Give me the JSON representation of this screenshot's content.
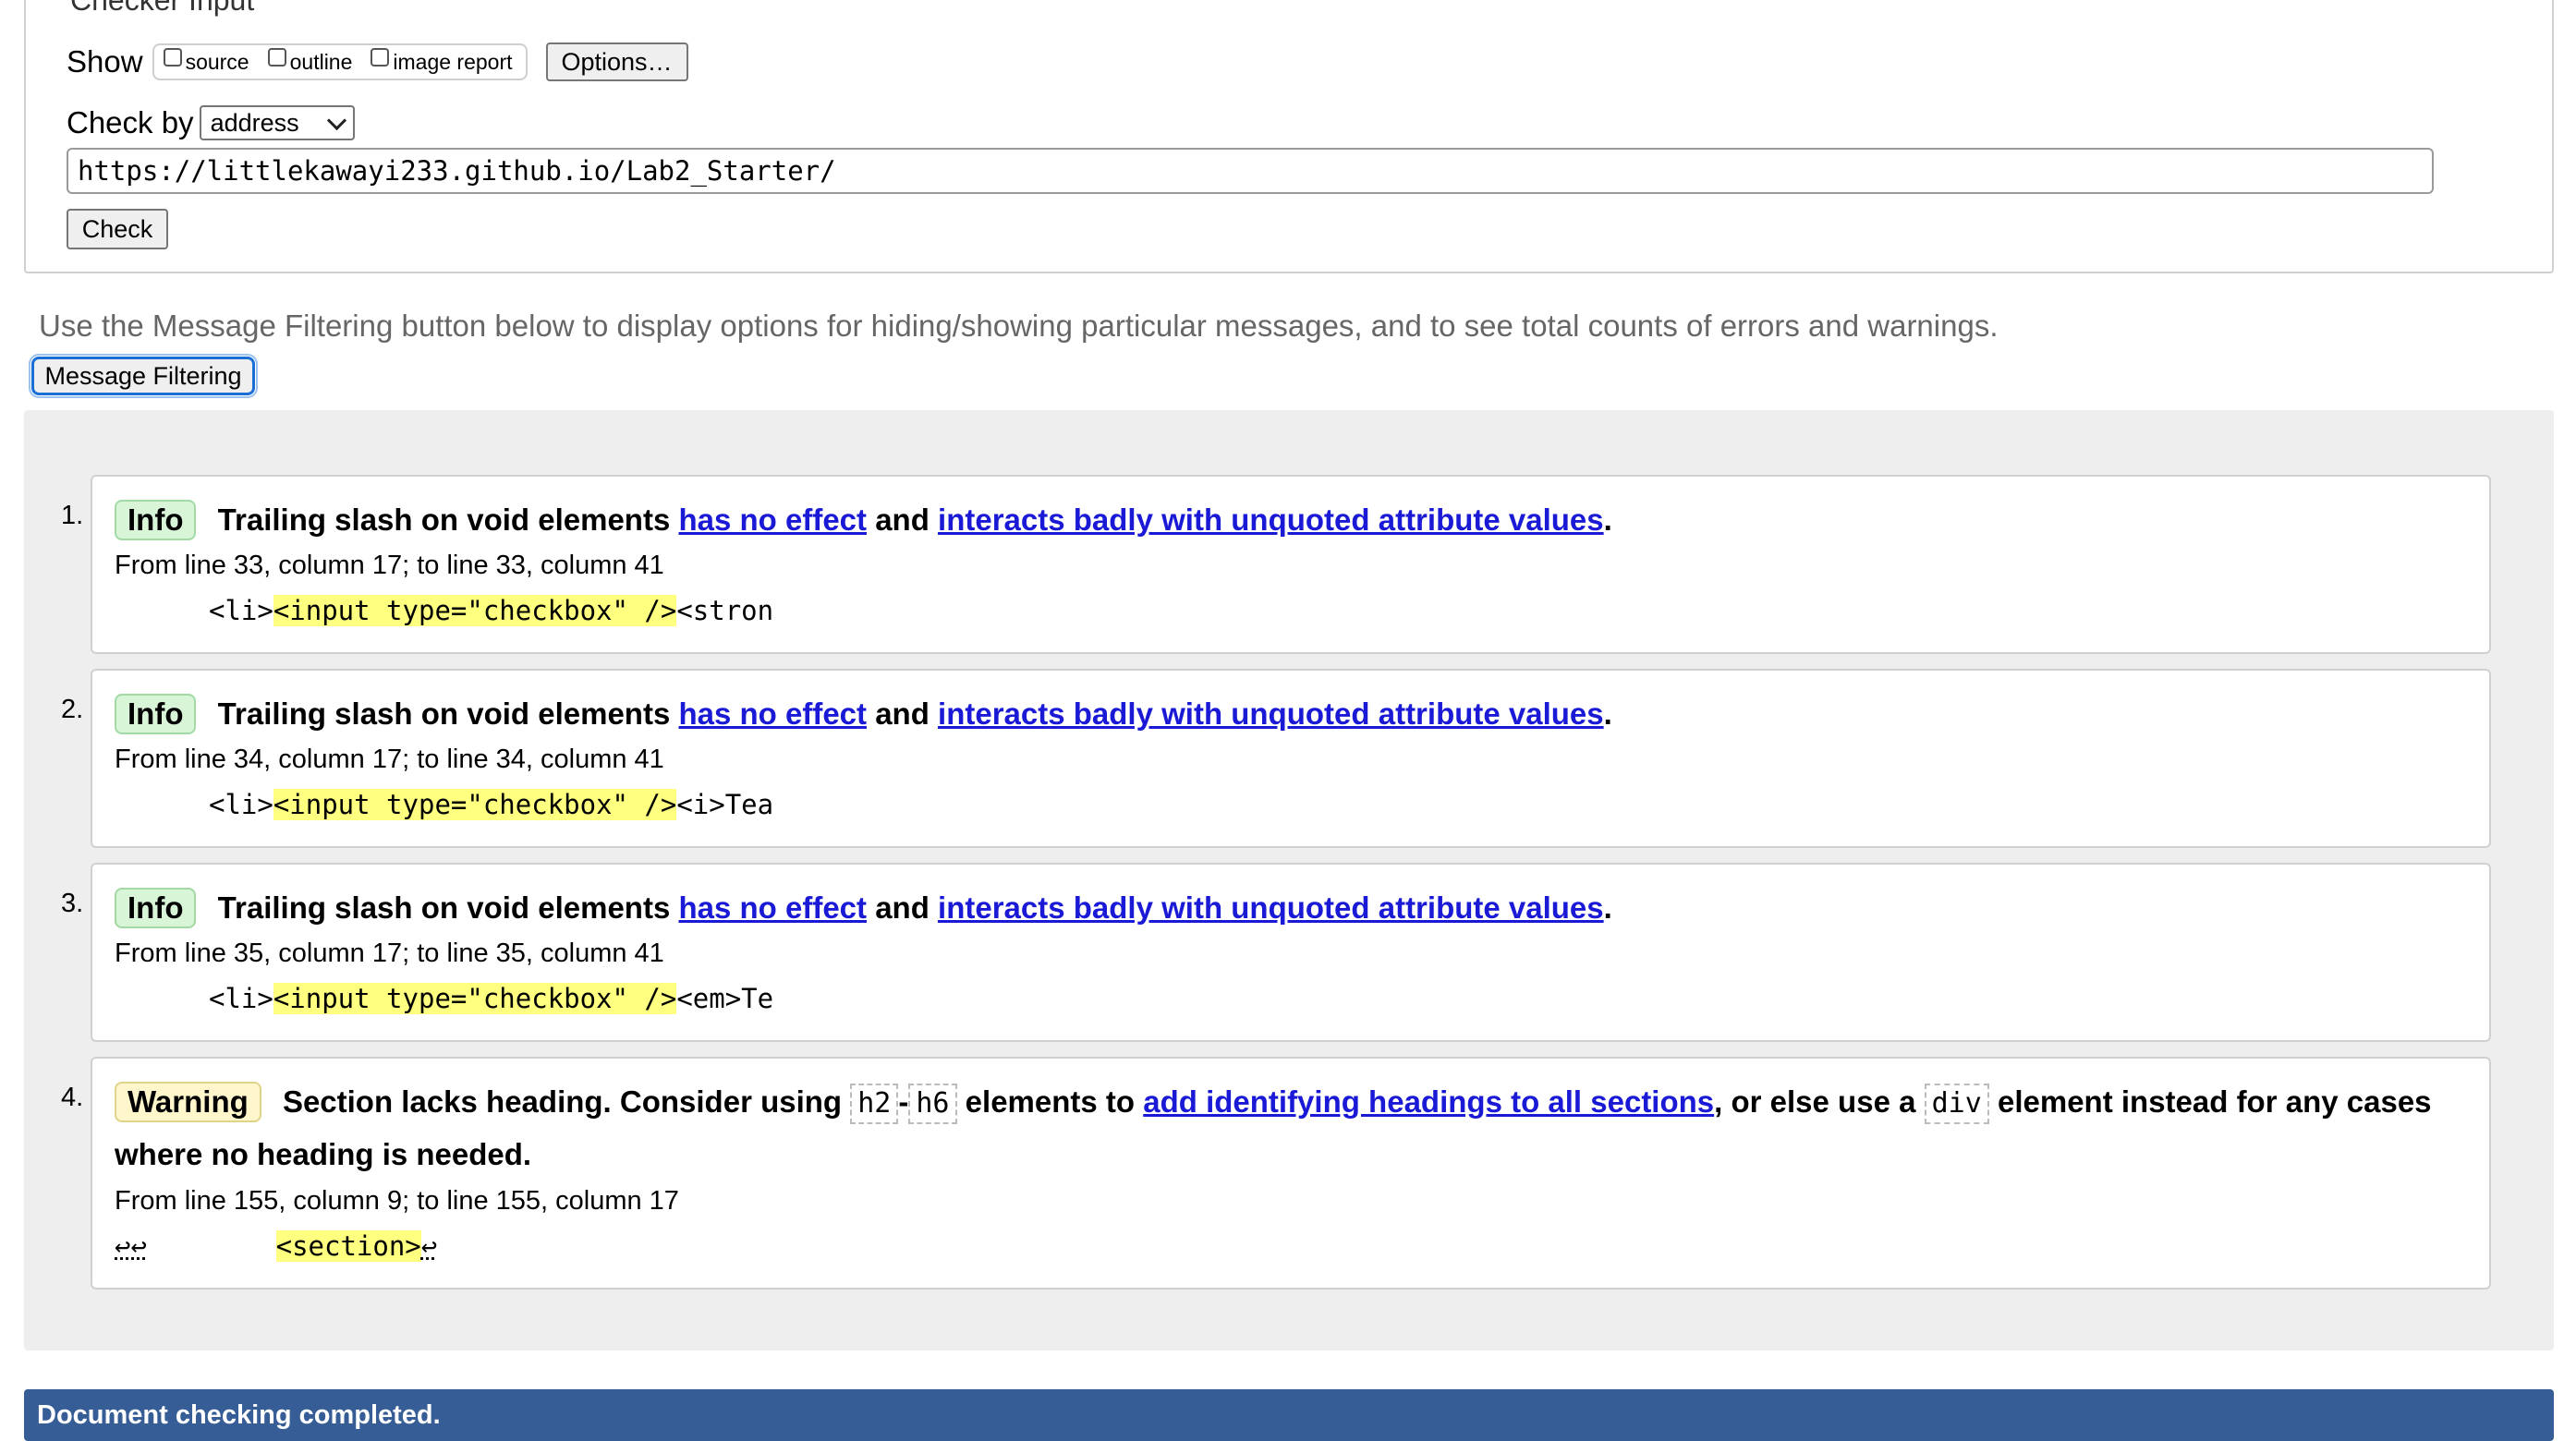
{
  "checker": {
    "legend": "Checker Input",
    "show_label": "Show",
    "show_options": [
      {
        "label": "source",
        "checked": false
      },
      {
        "label": "outline",
        "checked": false
      },
      {
        "label": "image report",
        "checked": false
      }
    ],
    "options_button": "Options…",
    "check_by_label": "Check by",
    "check_by_value": "address",
    "url_value": "https://littlekawayi233.github.io/Lab2_Starter/",
    "check_button": "Check"
  },
  "filter": {
    "hint": "Use the Message Filtering button below to display options for hiding/showing particular messages, and to see total counts of errors and warnings.",
    "button": "Message Filtering"
  },
  "messages": [
    {
      "number": "1.",
      "type": "Info",
      "text_a": "Trailing slash on void elements",
      "link1": "has no effect",
      "text_b": "and",
      "link2": "interacts badly with unquoted attribute values",
      "text_c": ".",
      "location": "From line 33, column 17; to line 33, column 41",
      "extract_pre": "<li>",
      "extract_hl": "<input type=\"checkbox\" />",
      "extract_post": "<stron"
    },
    {
      "number": "2.",
      "type": "Info",
      "text_a": "Trailing slash on void elements",
      "link1": "has no effect",
      "text_b": "and",
      "link2": "interacts badly with unquoted attribute values",
      "text_c": ".",
      "location": "From line 34, column 17; to line 34, column 41",
      "extract_pre": "<li>",
      "extract_hl": "<input type=\"checkbox\" />",
      "extract_post": "<i>Tea"
    },
    {
      "number": "3.",
      "type": "Info",
      "text_a": "Trailing slash on void elements",
      "link1": "has no effect",
      "text_b": "and",
      "link2": "interacts badly with unquoted attribute values",
      "text_c": ".",
      "location": "From line 35, column 17; to line 35, column 41",
      "extract_pre": "<li>",
      "extract_hl": "<input type=\"checkbox\" />",
      "extract_post": "<em>Te"
    },
    {
      "number": "4.",
      "type": "Warning",
      "text_a": "Section lacks heading. Consider using",
      "code1": "h2",
      "dash": "-",
      "code2": "h6",
      "text_b": "elements to",
      "link1": "add identifying headings to all sections",
      "text_c": ", or else use a",
      "code3": "div",
      "text_d": "element instead for any cases where no heading is needed.",
      "location": "From line 155, column 9; to line 155, column 17",
      "extract_pre": "↩↩",
      "extract_gap": "        ",
      "extract_hl": "<section>",
      "extract_post": "↩"
    }
  ],
  "status": "Document checking completed."
}
